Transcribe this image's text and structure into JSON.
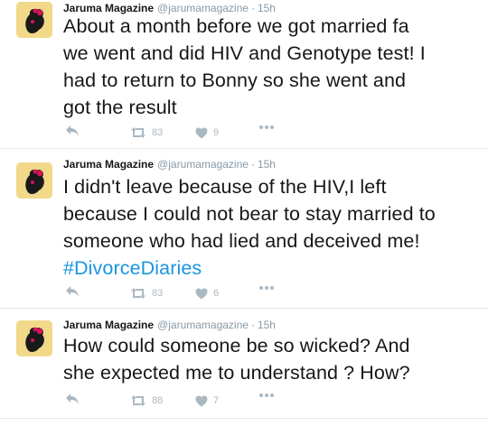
{
  "account": {
    "name": "Jaruma Magazine",
    "handle": "@jarumamagazine",
    "separator": "·"
  },
  "tweets": [
    {
      "time": "15h",
      "text_lines": [
        "About a month before we got married fa",
        "we went and did HIV and Genotype test! I",
        "had to return to Bonny so she went and",
        "got the result"
      ],
      "retweets": "83",
      "likes": "9"
    },
    {
      "time": "15h",
      "text_lines": [
        "I didn't leave because of the HIV,I left",
        "because I could not bear to stay married to",
        "someone who had lied and deceived me!"
      ],
      "hashtag": "#DivorceDiaries",
      "retweets": "83",
      "likes": "6"
    },
    {
      "time": "15h",
      "text_lines": [
        "How could someone be so wicked? And",
        "she expected me to understand ? How?"
      ],
      "retweets": "88",
      "likes": "7"
    }
  ],
  "icons": {
    "reply": "reply-icon",
    "retweet": "retweet-icon",
    "like": "heart-icon",
    "more": "more-icon"
  },
  "colors": {
    "text": "#14171a",
    "muted": "#8899a6",
    "action": "#aab8c2",
    "hashtag": "#1b95e0",
    "divider": "#e1e8ed"
  }
}
